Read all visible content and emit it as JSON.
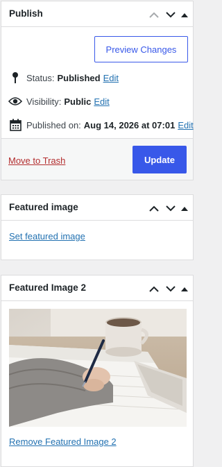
{
  "publish": {
    "title": "Publish",
    "preview_label": "Preview Changes",
    "status_label": "Status:",
    "status_value": "Published",
    "status_edit": "Edit",
    "visibility_label": "Visibility:",
    "visibility_value": "Public",
    "visibility_edit": "Edit",
    "published_label": "Published on:",
    "published_value": "Aug 14, 2026 at 07:01",
    "published_edit": "Edit",
    "trash_label": "Move to Trash",
    "update_label": "Update"
  },
  "featured_image": {
    "title": "Featured image",
    "set_label": "Set featured image"
  },
  "featured_image_2": {
    "title": "Featured Image 2",
    "remove_label": "Remove Featured Image 2"
  },
  "icons": {
    "move_up": "chevron-up-icon",
    "move_down": "chevron-down-icon",
    "toggle": "triangle-up-icon",
    "status": "pin-icon",
    "visibility": "eye-icon",
    "published": "calendar-icon"
  },
  "colors": {
    "accent": "#3858e9",
    "link": "#2271b1",
    "danger": "#b32d2e"
  }
}
